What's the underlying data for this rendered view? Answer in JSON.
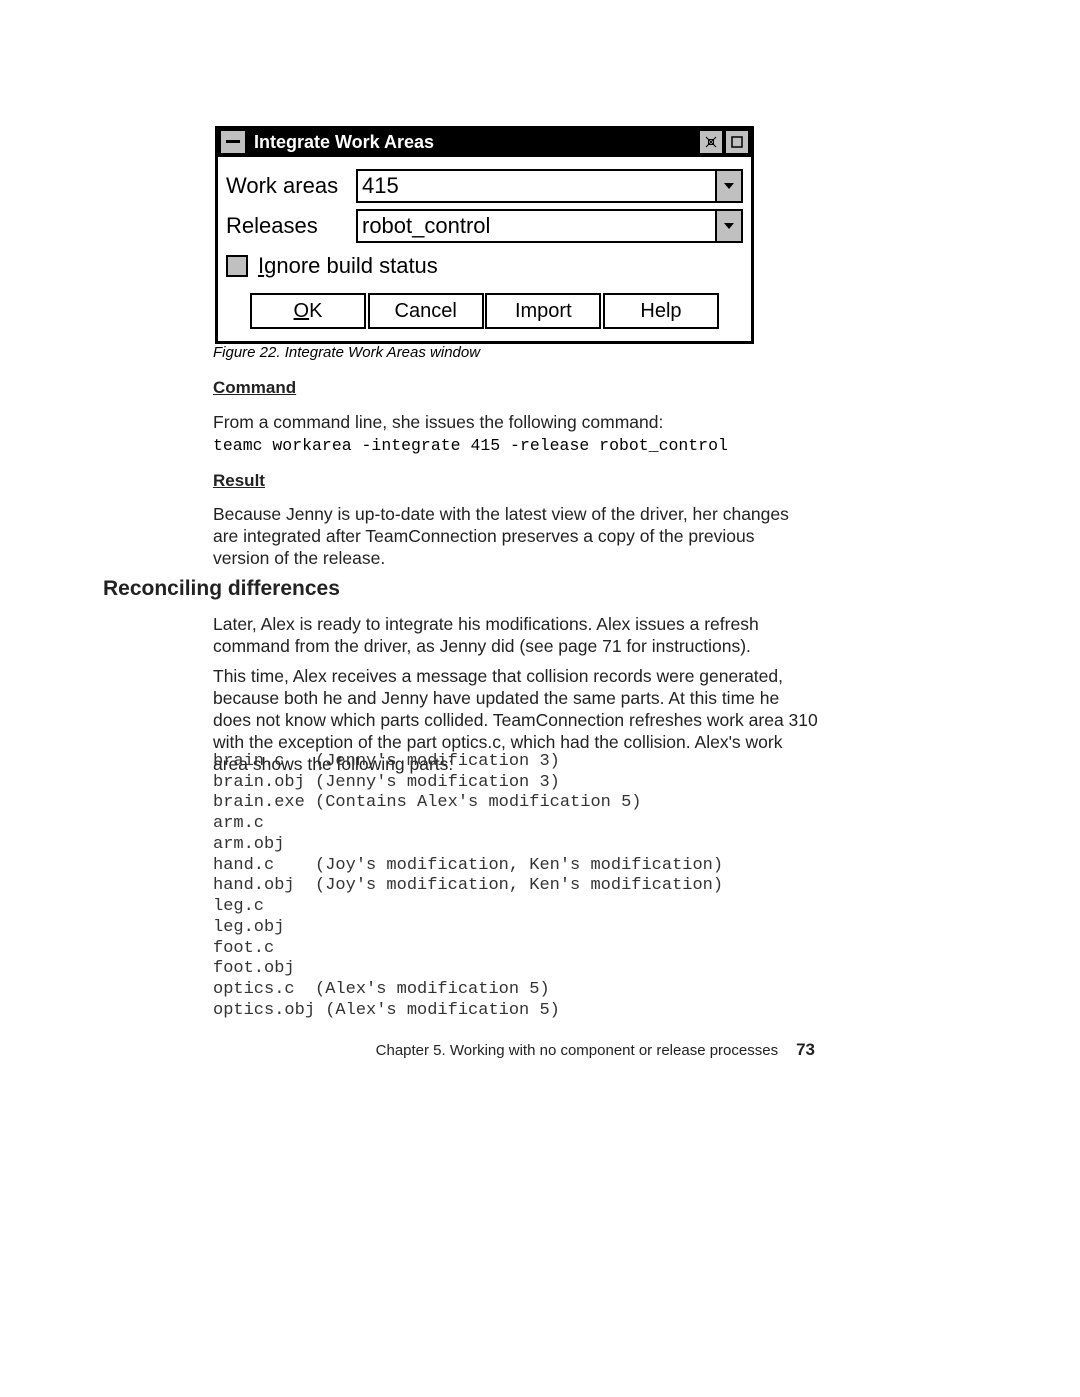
{
  "dialog": {
    "title": "Integrate Work Areas",
    "fields": {
      "work_areas": {
        "label": "Work areas",
        "value": "415"
      },
      "releases": {
        "label": "Releases",
        "value": "robot_control"
      }
    },
    "checkbox": {
      "label_prefix": "I",
      "label_rest": "gnore build status"
    },
    "buttons": {
      "ok": {
        "hot": "O",
        "rest": "K"
      },
      "cancel": "Cancel",
      "import": "Import",
      "help": "Help"
    }
  },
  "caption": "Figure 22. Integrate Work Areas window",
  "labels": {
    "command": "Command",
    "result": "Result"
  },
  "paragraphs": {
    "from_cmd": "From a command line, she issues the following command:",
    "mono_cmd": "teamc workarea -integrate 415 -release robot_control",
    "result_p": "Because Jenny is up-to-date with the latest view of the driver, her changes are integrated after TeamConnection preserves a copy of the previous version of the release.",
    "h2": "Reconciling differences",
    "later": "Later, Alex is ready to integrate his modifications. Alex issues a refresh command from the driver, as Jenny did (see page 71 for instructions).",
    "thistime": "This time, Alex receives a message that collision records were generated, because both he and Jenny have updated the same parts. At this time he does not know which parts collided. TeamConnection refreshes work area 310 with the exception of the part optics.c, which had the collision. Alex's work area shows the following parts:"
  },
  "codeblock": "brain.c   (Jenny's modification 3)\nbrain.obj (Jenny's modification 3)\nbrain.exe (Contains Alex's modification 5)\narm.c\narm.obj\nhand.c    (Joy's modification, Ken's modification)\nhand.obj  (Joy's modification, Ken's modification)\nleg.c\nleg.obj\nfoot.c\nfoot.obj\noptics.c  (Alex's modification 5)\noptics.obj (Alex's modification 5)",
  "footer": {
    "chapter": "Chapter 5. Working with no component or release processes",
    "page": "73"
  }
}
